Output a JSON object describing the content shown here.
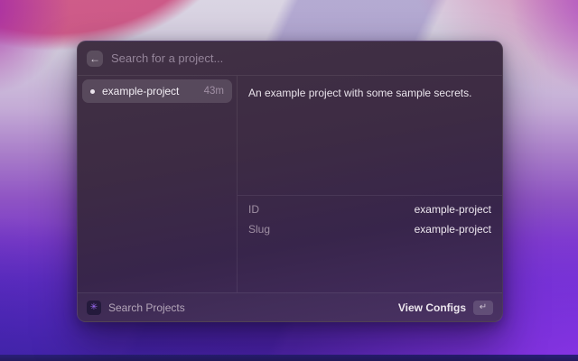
{
  "search_bar": {
    "placeholder": "Search for a project...",
    "back_icon": "←"
  },
  "project_list": {
    "items": [
      {
        "title": "example-project",
        "last_updated": "43m",
        "selected": true
      }
    ]
  },
  "detail_panel": {
    "description": "An example project with some sample secrets.",
    "metadata_rows": [
      {
        "label": "ID",
        "value": "example-project"
      },
      {
        "label": "Slug",
        "value": "example-project"
      }
    ]
  },
  "footer": {
    "app_icon_glyph": "✳",
    "primary_action": "Search Projects",
    "secondary_action": "View Configs",
    "secondary_shortcut": "↵"
  },
  "colors": {
    "accent_violet": "#9d6cf4",
    "selection_highlight": "rgba(255,255,255,0.13)",
    "window_base": "#3d2b44"
  }
}
